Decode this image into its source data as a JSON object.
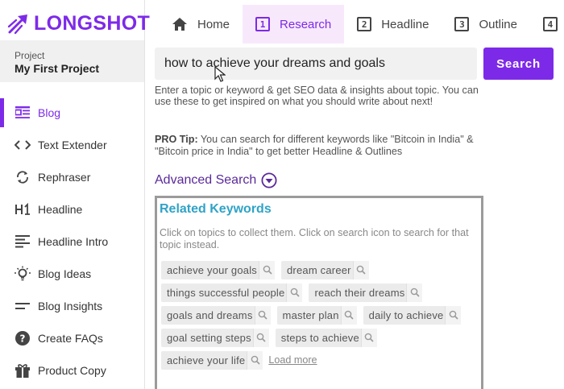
{
  "app": {
    "logo_text": "LONGSHOT",
    "brand_color": "#7d2ae8"
  },
  "project": {
    "label": "Project",
    "name": "My First Project"
  },
  "sidebar": {
    "items": [
      {
        "label": "Blog",
        "icon": "blog-icon",
        "active": true
      },
      {
        "label": "Text Extender",
        "icon": "code-brackets-icon",
        "active": false
      },
      {
        "label": "Rephraser",
        "icon": "refresh-icon",
        "active": false
      },
      {
        "label": "Headline",
        "icon": "h1-icon",
        "active": false
      },
      {
        "label": "Headline Intro",
        "icon": "intro-lines-icon",
        "active": false
      },
      {
        "label": "Blog Ideas",
        "icon": "lightbulb-icon",
        "active": false
      },
      {
        "label": "Blog Insights",
        "icon": "insights-lines-icon",
        "active": false
      },
      {
        "label": "Create FAQs",
        "icon": "help-circle-icon",
        "active": false
      },
      {
        "label": "Product Copy",
        "icon": "gift-icon",
        "active": false
      }
    ]
  },
  "tabs": [
    {
      "label": "Home",
      "icon": "home-icon",
      "active": false
    },
    {
      "label": "Research",
      "number": "1",
      "active": true
    },
    {
      "label": "Headline",
      "number": "2",
      "active": false
    },
    {
      "label": "Outline",
      "number": "3",
      "active": false
    },
    {
      "label": "",
      "number": "4",
      "active": false
    }
  ],
  "search": {
    "value": "how to achieve your dreams and goals",
    "button_label": "Search",
    "help_text": "Enter a topic or keyword & get SEO data & insights about topic. You can use these to get inspired on what you should write about next!",
    "pro_tip_label": "PRO Tip:",
    "pro_tip_text": " You can search for different keywords like \"Bitcoin in India\" & \"Bitcoin price in India\" to get better Headline & Outlines"
  },
  "advanced_search": {
    "label": "Advanced Search"
  },
  "related_keywords": {
    "title": "Related Keywords",
    "help_text": "Click on topics to collect them. Click on search icon to search for that topic instead.",
    "rows": [
      [
        "achieve your goals",
        "dream career"
      ],
      [
        "things successful people",
        "reach their dreams"
      ],
      [
        "goals and dreams",
        "master plan",
        "daily to achieve"
      ],
      [
        "goal setting steps",
        "steps to achieve"
      ],
      [
        "achieve your life"
      ]
    ],
    "load_more_label": "Load more"
  }
}
